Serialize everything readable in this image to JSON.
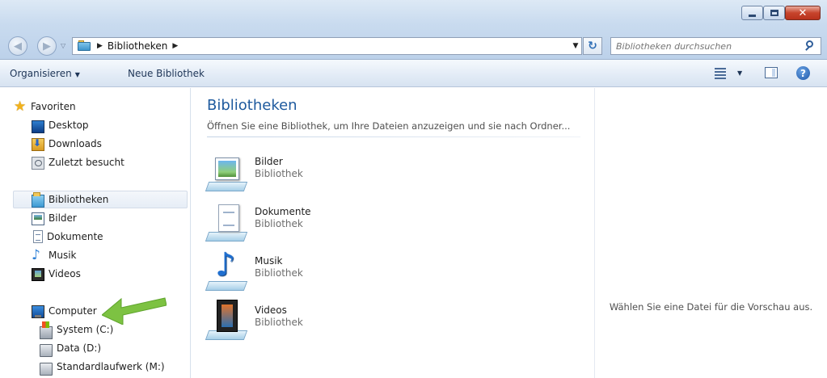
{
  "address": {
    "crumbs": [
      "Bibliotheken"
    ],
    "search_placeholder": "Bibliotheken durchsuchen"
  },
  "toolbar": {
    "organize": "Organisieren",
    "new_library": "Neue Bibliothek"
  },
  "nav": {
    "favorites": "Favoriten",
    "fav_items": [
      "Desktop",
      "Downloads",
      "Zuletzt besucht"
    ],
    "libraries": "Bibliotheken",
    "lib_items": [
      "Bilder",
      "Dokumente",
      "Musik",
      "Videos"
    ],
    "computer": "Computer",
    "drives": [
      "System (C:)",
      "Data (D:)",
      "Standardlaufwerk (M:)"
    ]
  },
  "content": {
    "title": "Bibliotheken",
    "subtitle": "Öffnen Sie eine Bibliothek, um Ihre Dateien anzuzeigen und sie nach Ordner...",
    "libraries": [
      {
        "name": "Bilder",
        "kind": "Bibliothek",
        "icon": "pictures-library-icon"
      },
      {
        "name": "Dokumente",
        "kind": "Bibliothek",
        "icon": "documents-library-icon"
      },
      {
        "name": "Musik",
        "kind": "Bibliothek",
        "icon": "music-library-icon"
      },
      {
        "name": "Videos",
        "kind": "Bibliothek",
        "icon": "videos-library-icon"
      }
    ]
  },
  "preview": {
    "text": "Wählen Sie eine Datei für die Vorschau aus."
  },
  "colors": {
    "accent_title": "#1e5a9e",
    "annotation_arrow": "#7dc242"
  }
}
